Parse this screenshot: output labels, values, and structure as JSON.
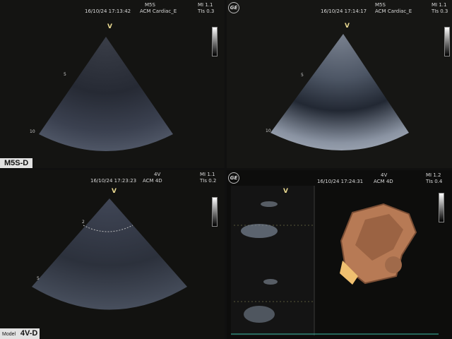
{
  "panels": [
    {
      "date": "16/10/24 17:13:42",
      "probe": "M5S",
      "preset": "ACM Cardiac_E",
      "mi": "MI 1.1",
      "tis": "TIs 0.3",
      "depth_top": "5",
      "depth_bottom": "10",
      "marker": "V"
    },
    {
      "date": "16/10/24 17:14:17",
      "probe": "M5S",
      "preset": "ACM Cardiac_E",
      "mi": "MI 1.1",
      "tis": "TIs 0.3",
      "depth_top": "5",
      "depth_bottom": "10",
      "marker": "V"
    },
    {
      "date": "16/10/24 17:23:23",
      "probe": "4V",
      "preset": "ACM 4D",
      "mi": "MI 1.1",
      "tis": "TIs 0.2",
      "depth_top": "2",
      "depth_bottom": "5",
      "marker": "V"
    },
    {
      "date": "16/10/24 17:24:31",
      "probe": "4V",
      "preset": "ACM 4D",
      "mi": "MI 1.2",
      "tis": "TIs 0.4",
      "marker": "V"
    }
  ],
  "logo": "GE",
  "label_m5s": "M5S-D",
  "label_model": "Model",
  "label_4v": "4V-D",
  "colors": {
    "background": "#101010",
    "text": "#d8d8d8",
    "marker": "#e8d890",
    "rendering": "#b77a55"
  },
  "icons": [
    "ge-logo-icon",
    "grayscale-bar-icon",
    "focus-arrow-icon"
  ]
}
